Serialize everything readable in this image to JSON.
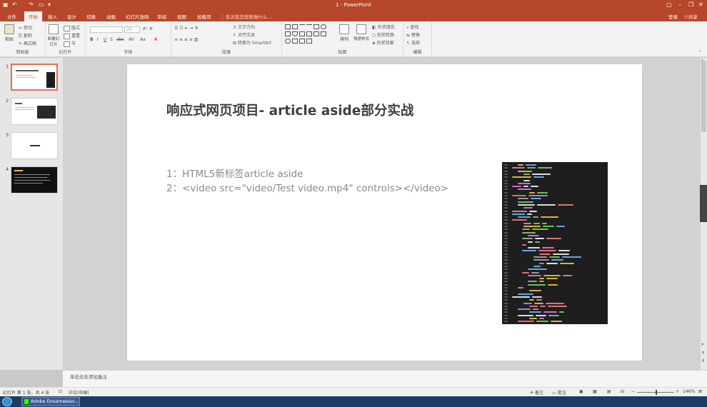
{
  "window": {
    "title": "1 - PowerPoint",
    "login_label": "登录",
    "share_label": "共享"
  },
  "tabs": [
    "文件",
    "开始",
    "插入",
    "设计",
    "切换",
    "动画",
    "幻灯片放映",
    "审阅",
    "视图",
    "加载项"
  ],
  "active_tab_index": 1,
  "tell_me": "告诉我您想要做什么...",
  "ribbon": {
    "clipboard": {
      "label": "剪贴板",
      "paste": "粘贴",
      "cut": "剪切",
      "copy": "复制",
      "format_painter": "格式刷"
    },
    "slides": {
      "label": "幻灯片",
      "new_slide": "新建幻灯片",
      "layout": "版式",
      "reset": "重置",
      "section": "节"
    },
    "font": {
      "label": "字体",
      "size": "20"
    },
    "paragraph": {
      "label": "段落",
      "text_direction": "文字方向",
      "align_text": "对齐文本",
      "convert_smartart": "转换为 SmartArt"
    },
    "drawing": {
      "label": "绘图",
      "arrange": "排列",
      "quick_styles": "快速样式",
      "shape_fill": "形状填充",
      "shape_outline": "形状轮廓",
      "shape_effects": "形状效果"
    },
    "editing": {
      "label": "编辑",
      "find": "查找",
      "replace": "替换",
      "select": "选择"
    }
  },
  "slides": {
    "numbers": [
      "1",
      "2",
      "3",
      "4"
    ],
    "selected": 1
  },
  "slide": {
    "title": "响应式网页项目- article  aside部分实战",
    "bullets": [
      "1：HTML5新标签article aside",
      "2：<video src=\"video/Test video.mp4\" controls></video>"
    ]
  },
  "notes_placeholder": "单击此处添加备注",
  "status": {
    "slide_info": "幻灯片 第 1 张，共 4 张",
    "language": "中文(中国)",
    "notes_btn": "备注",
    "comments_btn": "批注",
    "zoom": "146%"
  },
  "taskbar": {
    "item": "Adobe Dreamweav..."
  },
  "colors": {
    "accent": "#b7472a",
    "selected_thumb": "#e07050",
    "taskbar": "#1c3a66"
  }
}
